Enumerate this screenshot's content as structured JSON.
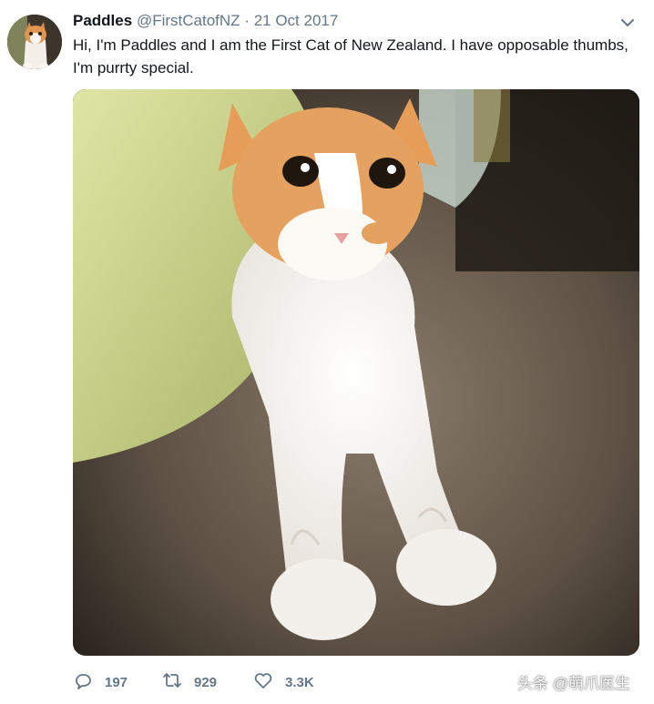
{
  "tweet": {
    "display_name": "Paddles",
    "handle": "@FirstCatofNZ",
    "separator": "·",
    "date": "21 Oct 2017",
    "text": "Hi, I'm Paddles and I am the First Cat of New Zealand. I have opposable thumbs, I'm purrty special."
  },
  "actions": {
    "reply_count": "197",
    "retweet_count": "929",
    "like_count": "3.3K"
  },
  "icons": {
    "more": "chevron-down-icon",
    "reply": "reply-icon",
    "retweet": "retweet-icon",
    "like": "heart-icon"
  },
  "watermark": "头条 @萌爪医生",
  "colors": {
    "text_primary": "#14171a",
    "text_secondary": "#657786"
  }
}
